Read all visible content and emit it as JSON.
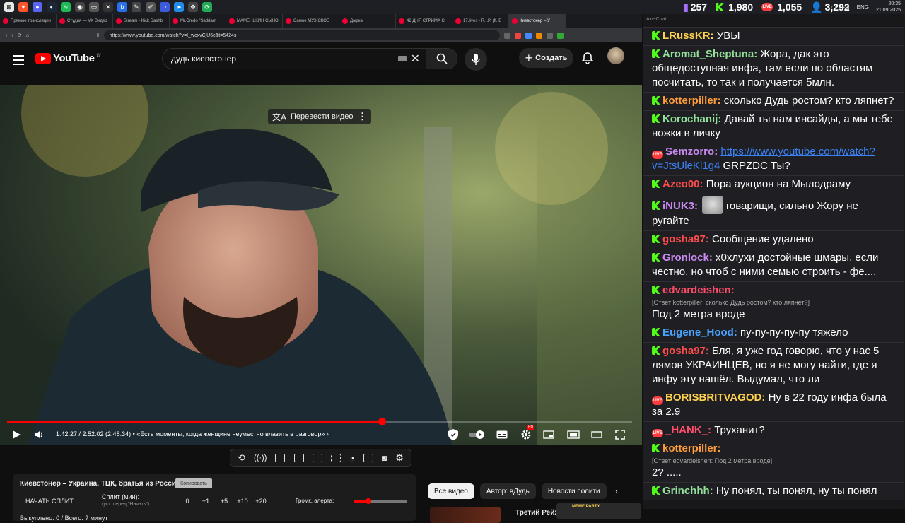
{
  "taskbar": {
    "time": "20:35",
    "date": "21.09.2025",
    "lang": "ENG"
  },
  "stats": {
    "viewers_twitch": "257",
    "viewers_kick": "1,980",
    "viewers_live": "1,055",
    "viewers_total": "3,292"
  },
  "browser": {
    "tabs": [
      "Прямые трансляции",
      "Студия — VK Видео",
      "Stream - Kick Dashb",
      "Mr.Credo \"Saddam I",
      "МАМЕНЬКИН СЫНО",
      "Самое МУЖСКОЕ",
      "Дырка",
      "42 ДНЯ СТРИМА С",
      "17.lives - R.I.P. (ft. E",
      "Киевстонер – У"
    ],
    "url": "https://www.youtube.com/watch?v=I_wcxvCjU6c&t=5424s"
  },
  "youtube": {
    "logo_text": "YouTube",
    "region": "LV",
    "search_value": "дудь киевстонер",
    "create_label": "Создать"
  },
  "player": {
    "translate_label": "Перевести видео",
    "progress": 0.6,
    "time_text": "1:42:27 / 2:52:02 (2:48:34)",
    "chapter": "«Есть моменты, когда женщине неуместно влазить в разговор»",
    "hd_badge": "HD"
  },
  "split": {
    "title": "Киевстонер – Украина, ТЦК, братья из России",
    "copy_label": "Копировать",
    "start_label": "НАЧАТЬ СПЛИТ",
    "split_label": "Сплит (мин):",
    "split_sub": "(уст. перед \"Начать\")",
    "nums": [
      "0",
      "+1",
      "+5",
      "+10",
      "+20"
    ],
    "alert_label": "Громк. алерта:",
    "bought": "Выкуплено: 0 / Всего: ? минут"
  },
  "chips": [
    "Все видео",
    "Автор: вДудь",
    "Новости полити"
  ],
  "rec": {
    "title": "Третий Рейх",
    "meme_text": "MEME PARTY"
  },
  "chat": {
    "header": "AxelChat",
    "messages": [
      {
        "badge": "kick",
        "user": "LRussKR",
        "color": "#ffd34d",
        "text": "УВЫ"
      },
      {
        "badge": "kick",
        "user": "Aromat_Sheptuna",
        "color": "#93e29a",
        "text": "Жора, дак это общедоступная инфа, там если по областям посчитать, то так и получается 5млн."
      },
      {
        "badge": "kick",
        "user": "kotterpiller",
        "color": "#ff9c3b",
        "text": "сколько Дудь ростом? кто ляпнет?"
      },
      {
        "badge": "kick",
        "user": "Korochanij",
        "color": "#93e29a",
        "text": "Давай ты нам инсайды, а мы тебе ножки в личку"
      },
      {
        "badge": "live",
        "user": "Semzorro",
        "color": "#c98af2",
        "link": "https://www.youtube.com/watch?v=JtsUleKl1g4",
        "text": "GRPZDC Ты?"
      },
      {
        "badge": "kick",
        "user": "Azeo00",
        "color": "#ff4d4d",
        "text": "Пора аукцион на Мылодраму"
      },
      {
        "badge": "kick",
        "user": "iNUK3",
        "color": "#c98af2",
        "text": "товарищи, сильно Жору не ругайте",
        "emote": "cat-emote"
      },
      {
        "badge": "kick",
        "user": "gosha97",
        "color": "#ff4d4d",
        "text": "Сообщение удалено"
      },
      {
        "badge": "kick",
        "user": "Gronlock",
        "color": "#c98af2",
        "text": "х0хлухи достойные шмары, если честно. но чтоб с ними семью строить - фе...."
      },
      {
        "badge": "kick",
        "user": "edvardeishen",
        "color": "#ff4d6a",
        "reply": "[Ответ kotterpiller: сколько Дудь ростом? кто ляпнет?]",
        "text": "Под 2 метра вроде"
      },
      {
        "badge": "kick",
        "user": "Eugene_Hood",
        "color": "#4aa3ff",
        "text": "пу-пу-пу-пу-пу тяжело"
      },
      {
        "badge": "kick",
        "user": "gosha97",
        "color": "#ff4d4d",
        "text": "Бля, я уже год говорю, что у нас 5 лямов УКРАИНЦЕВ, но я не могу найти, где я инфу эту нашёл. Выдумал, что ли"
      },
      {
        "badge": "live",
        "user": "BORISBRITVAGOD",
        "color": "#ffd34d",
        "text": "Ну в 22 году инфа была за 2.9"
      },
      {
        "badge": "live",
        "user": "_HANK_",
        "color": "#ff4d6a",
        "text": "Труханит?"
      },
      {
        "badge": "kick",
        "user": "kotterpiller",
        "color": "#ff9c3b",
        "reply": "[Ответ edvardeishen: Под 2 метра вроде]",
        "text": "2? ....."
      },
      {
        "badge": "kick",
        "user": "Grinchhh",
        "color": "#93e29a",
        "text": "Ну понял, ты понял, ну ты понял"
      }
    ]
  }
}
